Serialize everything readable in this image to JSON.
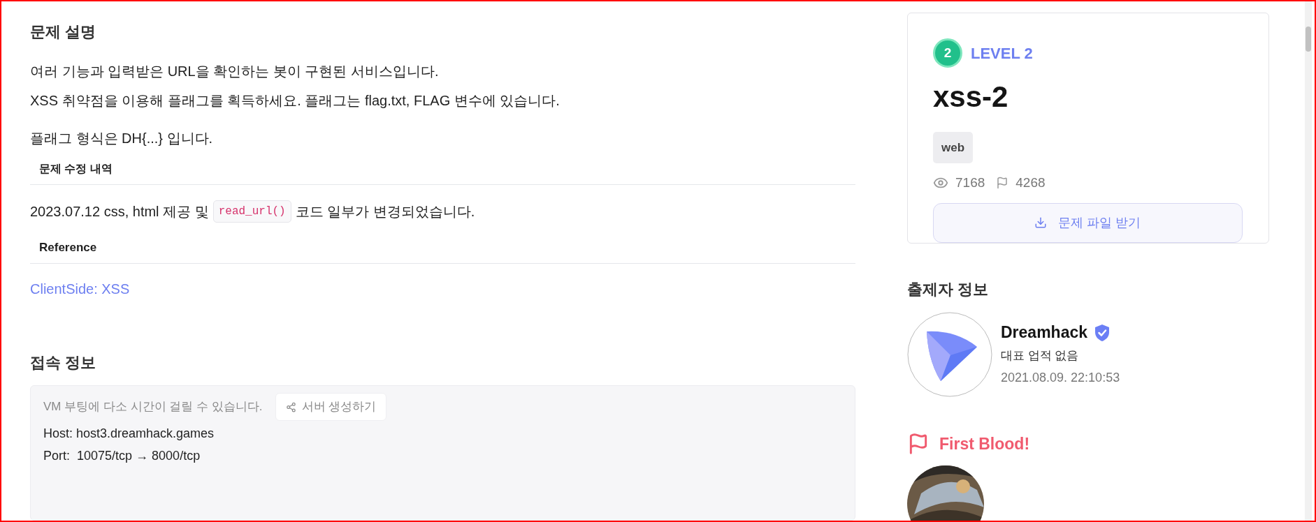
{
  "description": {
    "heading": "문제 설명",
    "paragraphs": [
      "여러 기능과 입력받은 URL을 확인하는 봇이 구현된 서비스입니다.",
      "XSS 취약점을 이용해 플래그를 획득하세요. 플래그는 flag.txt, FLAG 변수에 있습니다."
    ],
    "flag_format": "플래그 형식은 DH{...} 입니다.",
    "changes_heading": "문제 수정 내역",
    "change": {
      "before": "2023.07.12 css, html 제공 및",
      "code": "read_url()",
      "after": "코드 일부가 변경되었습니다."
    },
    "reference_heading": "Reference",
    "reference_link": "ClientSide: XSS"
  },
  "connection": {
    "heading": "접속 정보",
    "notice": "VM 부팅에 다소 시간이 걸릴 수 있습니다.",
    "create_button": "서버 생성하기",
    "host": "Host: host3.dreamhack.games",
    "port": "Port:  10075/tcp → 8000/tcp"
  },
  "challenge": {
    "level_number": "2",
    "level_label": "LEVEL 2",
    "title": "xss-2",
    "tags": [
      "web"
    ],
    "views": "7168",
    "solves": "4268",
    "download_button": "문제 파일 받기"
  },
  "author": {
    "heading": "출제자 정보",
    "name": "Dreamhack",
    "verified": true,
    "achievement": "대표 업적 없음",
    "date": "2021.08.09. 22:10:53"
  },
  "first_blood": {
    "heading": "First Blood!"
  }
}
